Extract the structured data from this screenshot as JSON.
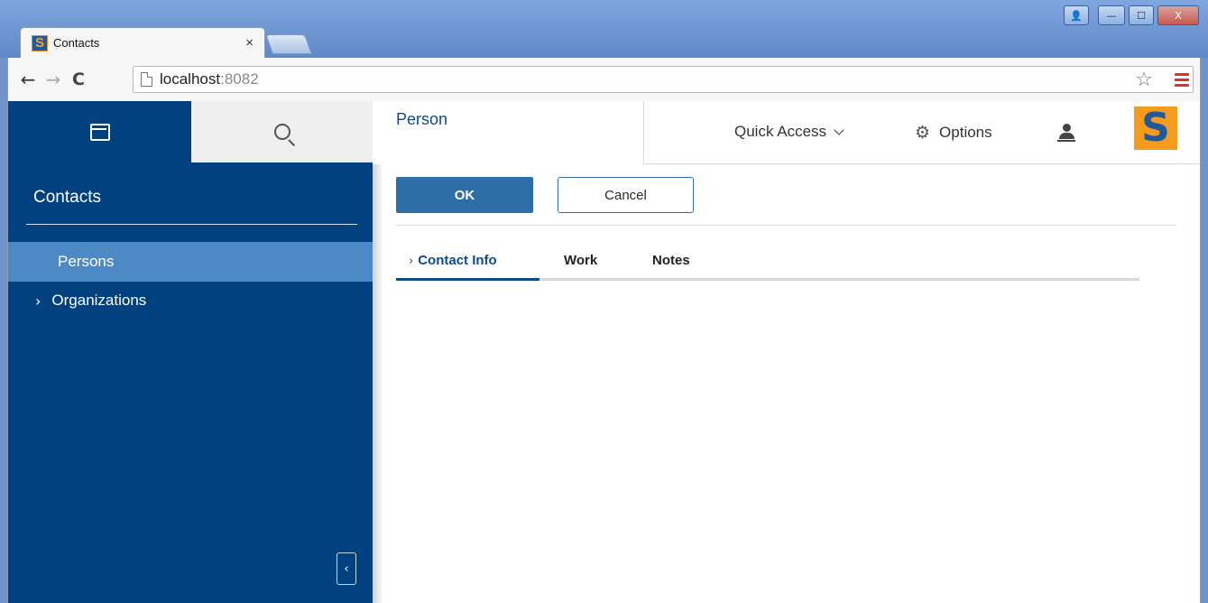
{
  "browser": {
    "tab_title": "Contacts",
    "tab_close": "×",
    "favicon_letter": "S",
    "url_host": "localhost",
    "url_port": ":8082",
    "window_controls": {
      "user": "👤",
      "minimize": "—",
      "maximize": "☐",
      "close": "X"
    },
    "icons": [
      "back-arrow-icon",
      "forward-arrow-icon",
      "reload-icon",
      "page-icon",
      "star-icon",
      "hamburger-menu-icon"
    ]
  },
  "sidebar": {
    "title": "Contacts",
    "items": [
      {
        "label": "Persons",
        "selected": true
      },
      {
        "label": "Organizations",
        "selected": false
      }
    ],
    "collapse_label": "‹"
  },
  "header": {
    "view_title": "Person",
    "quick_access": "Quick Access",
    "options": "Options",
    "logo_letter": "S"
  },
  "form": {
    "ok_label": "OK",
    "cancel_label": "Cancel",
    "tabs": [
      {
        "label": "Contact Info",
        "active": true
      },
      {
        "label": "Work",
        "active": false
      },
      {
        "label": "Notes",
        "active": false
      }
    ]
  },
  "colors": {
    "sidebar_bg": "#01417f",
    "selected_item": "#4d89c5",
    "primary_button": "#2e6ea7",
    "logo_orange": "#f59c1e"
  }
}
